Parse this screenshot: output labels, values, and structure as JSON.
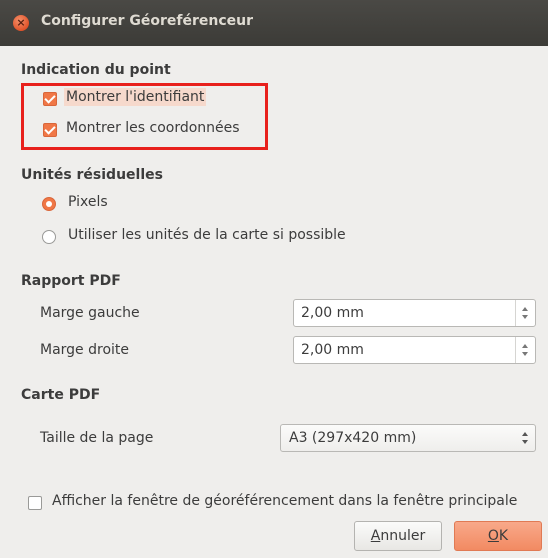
{
  "window": {
    "title": "Configurer Géoreférenceur",
    "close_glyph": "×"
  },
  "point_indication": {
    "section_label": "Indication du point",
    "show_id_label": "Montrer l'identifiant",
    "show_id_checked": true,
    "show_coords_label": "Montrer les coordonnées",
    "show_coords_checked": true
  },
  "residual_units": {
    "section_label": "Unités résiduelles",
    "options": [
      {
        "label": "Pixels",
        "selected": true
      },
      {
        "label": "Utiliser les unités de la carte si possible",
        "selected": false
      }
    ]
  },
  "pdf_report": {
    "section_label": "Rapport PDF",
    "left_margin_label": "Marge gauche",
    "left_margin_value": "2,00 mm",
    "right_margin_label": "Marge droite",
    "right_margin_value": "2,00 mm"
  },
  "pdf_map": {
    "section_label": "Carte PDF",
    "page_size_label": "Taille de la page",
    "page_size_value": "A3 (297x420 mm)"
  },
  "footer": {
    "show_in_main_label": "Afficher la fenêtre de géoréférencement dans la fenêtre principale",
    "show_in_main_checked": false,
    "cancel_label_mnemonic": "A",
    "cancel_label_rest": "nnuler",
    "ok_label_mnemonic": "O",
    "ok_label_rest": "K"
  },
  "colors": {
    "accent": "#f07746",
    "highlight_box": "#e8201c",
    "titlebar": "#3c3b37"
  },
  "icons": {
    "close": "close-icon",
    "checkbox": "checkbox-icon",
    "radio": "radio-icon"
  }
}
